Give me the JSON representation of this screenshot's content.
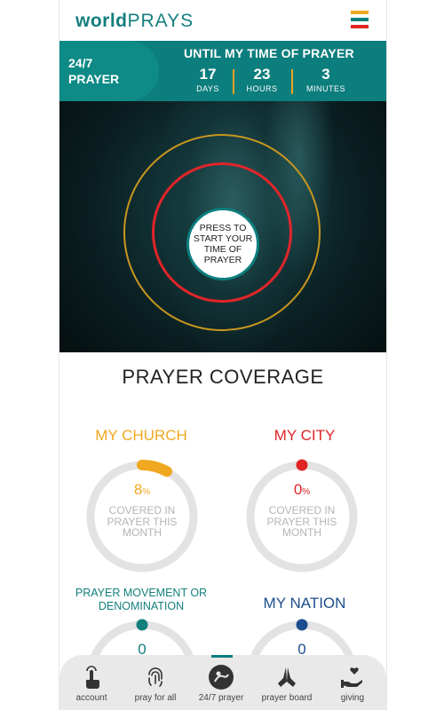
{
  "header": {
    "logo_bold": "world",
    "logo_light": "PRAYS"
  },
  "timer": {
    "tab_line1": "24/7",
    "tab_line2": "PRAYER",
    "title": "UNTIL MY TIME OF PRAYER",
    "days_value": "17",
    "days_unit": "DAYS",
    "hours_value": "23",
    "hours_unit": "HOURS",
    "minutes_value": "3",
    "minutes_unit": "MINUTES"
  },
  "hero": {
    "press_line1": "PRESS TO",
    "press_line2": "START YOUR",
    "press_line3": "TIME OF",
    "press_line4": "PRAYER"
  },
  "coverage": {
    "title": "PRAYER COVERAGE",
    "church": {
      "label": "MY CHURCH",
      "value": "8",
      "unit": "%",
      "desc": "COVERED IN PRAYER THIS MONTH",
      "fraction": 0.08,
      "color": "#f0a820"
    },
    "city": {
      "label": "MY CITY",
      "value": "0",
      "unit": "%",
      "desc": "COVERED IN PRAYER THIS MONTH",
      "fraction": 0.0,
      "color": "#e02525"
    },
    "movement": {
      "label_line1": "PRAYER MOVEMENT OR",
      "label_line2": "DENOMINATION",
      "value": "0",
      "color": "#137f7c"
    },
    "nation": {
      "label": "MY NATION",
      "value": "0",
      "color": "#1d4e8f"
    }
  },
  "nav": {
    "account": "account",
    "pray_for_all": "pray for all",
    "prayer_247": "24/7 prayer",
    "prayer_board": "prayer board",
    "giving": "giving"
  },
  "colors": {
    "brand_teal": "#0c7e7d",
    "orange": "#f0a820",
    "red": "#e02525",
    "navy": "#1d4e8f"
  }
}
